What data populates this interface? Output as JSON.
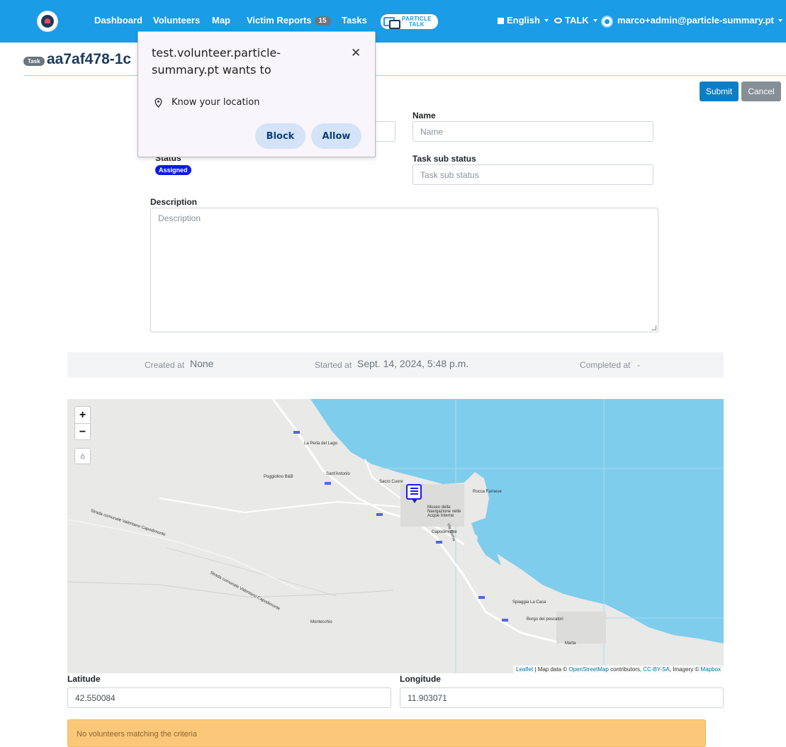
{
  "nav": {
    "links": [
      "Dashboard",
      "Volunteers",
      "Map",
      "Victim Reports",
      "Tasks"
    ],
    "victim_reports_count": "15",
    "particle_talk_logo": [
      "PARTICLE",
      "TALK"
    ],
    "language": "English",
    "talk": "TALK",
    "user_email": "marco+admin@particle-summary.pt",
    "bg_color": "#1a9ce6"
  },
  "header": {
    "badge": "Task",
    "task_id": "aa7af478-1c"
  },
  "actions": {
    "submit": "Submit",
    "cancel": "Cancel"
  },
  "form": {
    "name_label": "Name",
    "name_placeholder": "Name",
    "status_label": "Status",
    "status_value": "Assigned",
    "sub_status_label": "Task sub status",
    "sub_status_placeholder": "Task sub status",
    "description_label": "Description",
    "description_placeholder": "Description"
  },
  "dates": {
    "created_label": "Created at",
    "created_value": "None",
    "started_label": "Started at",
    "started_value": "Sept. 14, 2024, 5:48 p.m.",
    "completed_label": "Completed at",
    "completed_value": "-"
  },
  "map": {
    "attribution_leaflet": "Leaflet",
    "attribution_text": " | Map data © ",
    "attribution_osm": "OpenStreetMap",
    "attribution_contrib": " contributors, ",
    "attribution_license": "CC-BY-SA",
    "attribution_imagery": ", Imagery © ",
    "attribution_mapbox": "Mapbox",
    "labels": [
      "La Perla del Lago",
      "Sant'Antonio",
      "Sacro Cuore",
      "Capodimonte",
      "Poggiolino B&B",
      "Marta",
      "Montecchio",
      "Spiaggia La Casa",
      "Borgo dei pescatori",
      "Museo della Navigazione nelle Acque Interne",
      "Strada comunale Valentano Capodimonte",
      "Strada comunale Valentano Capodimonte",
      "Rocca Farnese",
      "Via Roma"
    ],
    "water_color": "#7fcdec"
  },
  "coords": {
    "lat_label": "Latitude",
    "lat_value": "42.550084",
    "lng_label": "Longitude",
    "lng_value": "11.903071"
  },
  "alert": "No volunteers matching the criteria",
  "popup": {
    "title": "test.volunteer.particle-summary.pt wants to",
    "permission": "Know your location",
    "block": "Block",
    "allow": "Allow"
  }
}
